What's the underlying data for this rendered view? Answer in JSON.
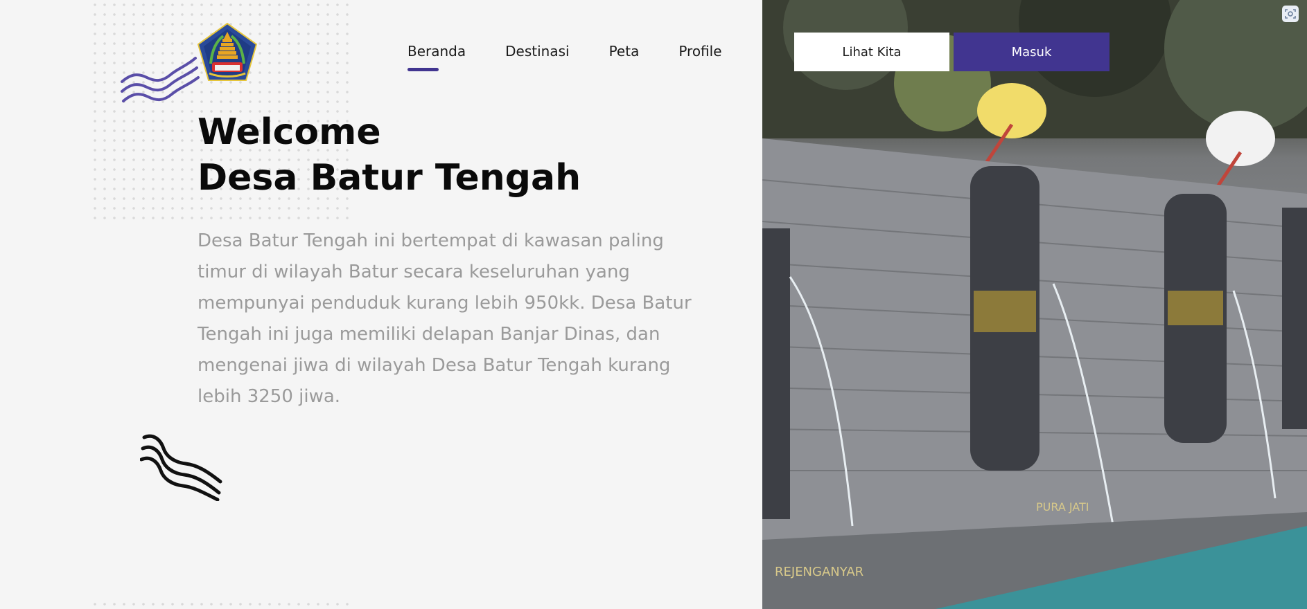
{
  "nav": {
    "items": [
      {
        "label": "Beranda",
        "active": true
      },
      {
        "label": "Destinasi",
        "active": false
      },
      {
        "label": "Peta",
        "active": false
      },
      {
        "label": "Profile",
        "active": false
      }
    ]
  },
  "buttons": {
    "lihat_kita": "Lihat Kita",
    "masuk": "Masuk"
  },
  "hero": {
    "title_line1": "Welcome",
    "title_line2": "Desa Batur Tengah",
    "description": "Desa Batur Tengah ini bertempat di kawasan paling timur di wilayah Batur secara keseluruhan yang mempunyai penduduk kurang lebih 950kk. Desa Batur Tengah ini juga memiliki delapan Banjar Dinas, dan mengenai jiwa di wilayah Desa Batur Tengah kurang lebih 3250 jiwa.",
    "image_labels": [
      "PURA JATI",
      "REJENGANYAR"
    ]
  },
  "colors": {
    "accent": "#413590",
    "background": "#f5f5f5",
    "wave_purple": "#5a4ea8"
  },
  "icons": {
    "logo": "bali-emblem-icon",
    "corner": "screen-capture-icon"
  }
}
